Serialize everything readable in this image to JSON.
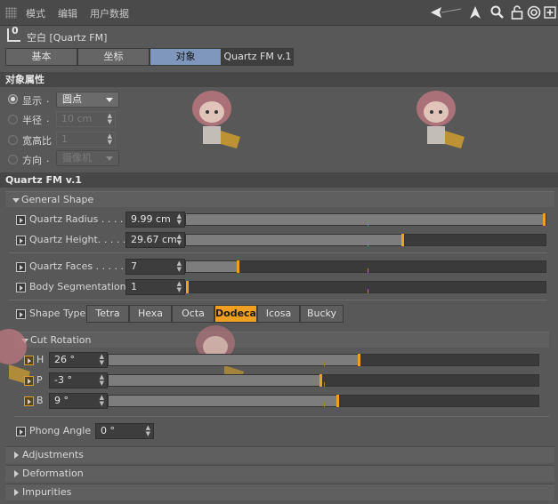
{
  "menu": {
    "items": [
      "模式",
      "编辑",
      "用户数据"
    ]
  },
  "toolbar_icons": [
    "back-arrow-icon",
    "cursor-icon",
    "search-icon",
    "lock-icon",
    "target-icon",
    "add-panel-icon"
  ],
  "header": {
    "object_title": "空白 [Quartz FM]",
    "object_icon_glyph": "0"
  },
  "tabs": [
    {
      "label": "基本",
      "active": false
    },
    {
      "label": "坐标",
      "active": false
    },
    {
      "label": "对象",
      "active": true
    },
    {
      "label": "Quartz FM v.1",
      "active": false
    }
  ],
  "object_properties": {
    "title": "对象属性",
    "display": {
      "label": "显示",
      "value": "圆点"
    },
    "radius": {
      "label": "半径",
      "value": "10 cm"
    },
    "aspect": {
      "label": "宽高比",
      "value": "1"
    },
    "orientation": {
      "label": "方向",
      "value": "摄像机"
    }
  },
  "plugin": {
    "title": "Quartz FM v.1",
    "general_shape": {
      "title": "General Shape",
      "quartz_radius": {
        "label": "Quartz Radius . . . . .",
        "value": "9.99 cm",
        "fraction": 1.0
      },
      "quartz_height": {
        "label": "Quartz Height. . . . .",
        "value": "29.67 cm",
        "fraction": 0.6
      },
      "quartz_faces": {
        "label": "Quartz Faces . . . . . .",
        "value": "7",
        "fraction": 0.14
      },
      "body_segmentation": {
        "label": "Body Segmentation",
        "value": "1",
        "fraction": 0.0
      },
      "shape_type": {
        "label": "Shape Type",
        "options": [
          "Tetra",
          "Hexa",
          "Octa",
          "Dodeca",
          "Icosa",
          "Bucky"
        ],
        "selected": "Dodeca"
      }
    },
    "cut_rotation": {
      "title": "Cut Rotation",
      "h": {
        "label": "H",
        "value": "26 °",
        "fraction": 0.58
      },
      "p": {
        "label": "P",
        "value": "-3 °",
        "fraction": 0.49
      },
      "b": {
        "label": "B",
        "value": "9 °",
        "fraction": 0.53
      }
    },
    "phong_angle": {
      "label": "Phong Angle",
      "value": "0 °"
    },
    "adjustments": "Adjustments",
    "deformation": "Deformation",
    "impurities": "Impurities"
  },
  "colors": {
    "accent": "#f0a020",
    "active_tab": "#7f97bd",
    "panel_bg": "#585858"
  }
}
